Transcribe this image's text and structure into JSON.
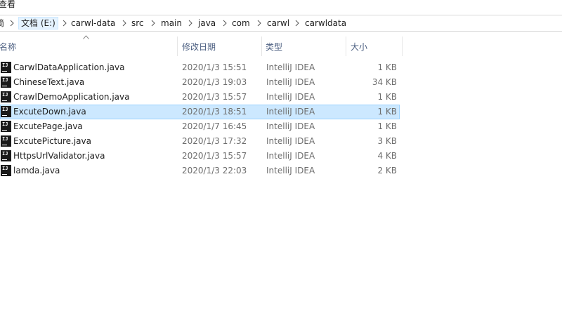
{
  "menu": {
    "view_label": "查看"
  },
  "breadcrumb": {
    "items": [
      "文档 (E:)",
      "carwl-data",
      "src",
      "main",
      "java",
      "com",
      "carwl",
      "carwldata"
    ],
    "left_fragment": "简"
  },
  "columns": {
    "name": "名称",
    "date": "修改日期",
    "type": "类型",
    "size": "大小"
  },
  "files": [
    {
      "icon": "intellij-java-file-icon",
      "name": "CarwlDataApplication.java",
      "date": "2020/1/3 15:51",
      "type": "IntelliJ IDEA",
      "size": "1 KB",
      "selected": false
    },
    {
      "icon": "intellij-java-file-icon",
      "name": "ChineseText.java",
      "date": "2020/1/3 19:03",
      "type": "IntelliJ IDEA",
      "size": "34 KB",
      "selected": false
    },
    {
      "icon": "intellij-java-file-icon",
      "name": "CrawlDemoApplication.java",
      "date": "2020/1/3 15:57",
      "type": "IntelliJ IDEA",
      "size": "1 KB",
      "selected": false
    },
    {
      "icon": "intellij-java-file-icon",
      "name": "ExcuteDown.java",
      "date": "2020/1/3 18:51",
      "type": "IntelliJ IDEA",
      "size": "1 KB",
      "selected": true
    },
    {
      "icon": "intellij-java-file-icon",
      "name": "ExcutePage.java",
      "date": "2020/1/7 16:45",
      "type": "IntelliJ IDEA",
      "size": "1 KB",
      "selected": false
    },
    {
      "icon": "intellij-java-file-icon",
      "name": "ExcutePicture.java",
      "date": "2020/1/3 17:32",
      "type": "IntelliJ IDEA",
      "size": "3 KB",
      "selected": false
    },
    {
      "icon": "intellij-java-file-icon",
      "name": "HttpsUrlValidator.java",
      "date": "2020/1/3 15:57",
      "type": "IntelliJ IDEA",
      "size": "4 KB",
      "selected": false
    },
    {
      "icon": "intellij-java-file-icon",
      "name": "lamda.java",
      "date": "2020/1/3 22:03",
      "type": "IntelliJ IDEA",
      "size": "2 KB",
      "selected": false
    }
  ],
  "icon_glyph": "IJ",
  "colors": {
    "selection_bg": "#cce8ff",
    "selection_border": "#99d1ff",
    "header_text": "#4d6082"
  }
}
